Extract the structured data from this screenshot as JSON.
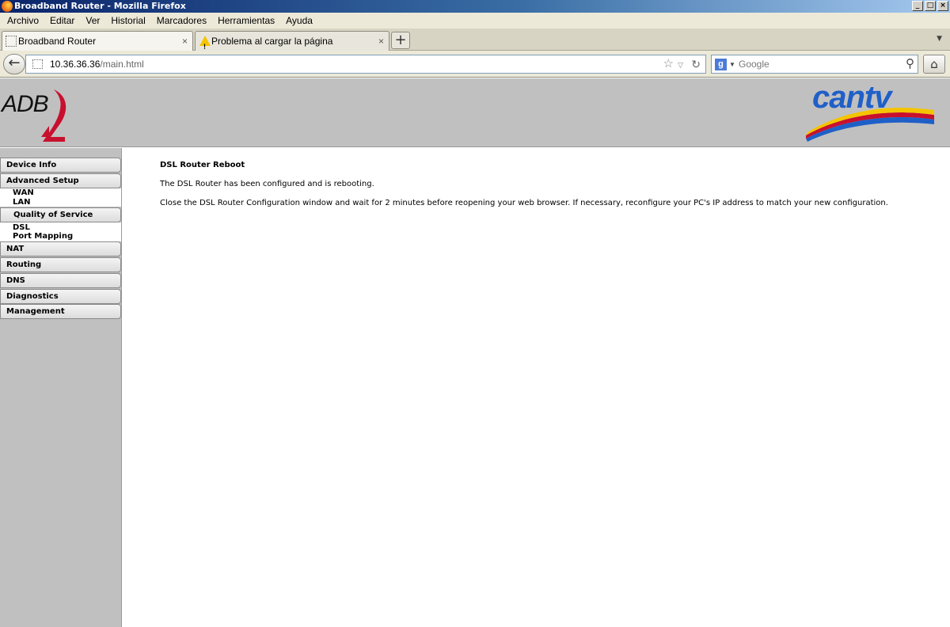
{
  "window": {
    "title": "Broadband Router - Mozilla Firefox",
    "buttons": {
      "minimize": "_",
      "maximize": "□",
      "close": "×"
    }
  },
  "menu": [
    "Archivo",
    "Editar",
    "Ver",
    "Historial",
    "Marcadores",
    "Herramientas",
    "Ayuda"
  ],
  "tabs": [
    {
      "label": "Broadband Router",
      "close": "×",
      "active": true
    },
    {
      "label": "Problema al cargar la página",
      "close": "×",
      "active": false
    }
  ],
  "new_tab_label": "+",
  "nav": {
    "back": "←",
    "url_host": "10.36.36.36",
    "url_path": "/main.html",
    "search_placeholder": "Google",
    "home": "⌂"
  },
  "logos": {
    "left": "ADB",
    "right": "cantv"
  },
  "sidebar": {
    "device_info": "Device Info",
    "advanced_setup": "Advanced Setup",
    "wan": "WAN",
    "lan": "LAN",
    "qos": "Quality of Service",
    "dsl": "DSL",
    "port_mapping": "Port Mapping",
    "nat": "NAT",
    "routing": "Routing",
    "dns": "DNS",
    "diagnostics": "Diagnostics",
    "management": "Management"
  },
  "content": {
    "title": "DSL Router Reboot",
    "p1": "The DSL Router has been configured and is rebooting.",
    "p2": "Close the DSL Router Configuration window and wait for 2 minutes before reopening your web browser. If necessary, reconfigure your PC's IP address to match your new configuration."
  },
  "colors": {
    "accent": "#0a246a",
    "brand_blue": "#1f5fc8",
    "brand_red": "#c8102e"
  }
}
